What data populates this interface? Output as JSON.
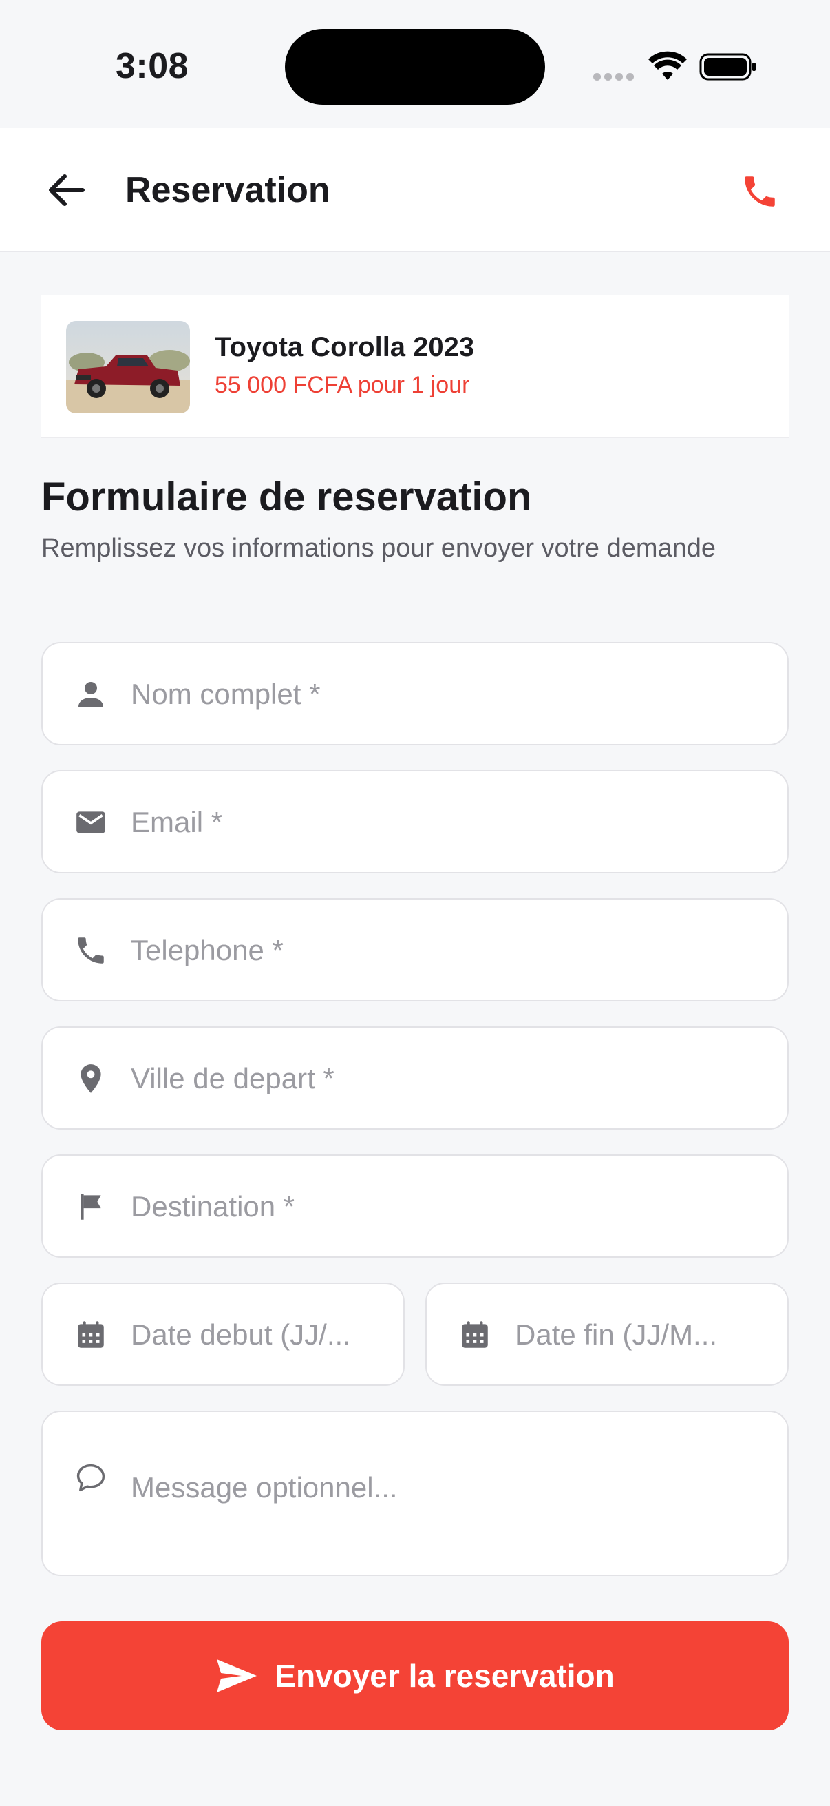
{
  "status_bar": {
    "time": "3:08"
  },
  "app_bar": {
    "title": "Reservation",
    "back_icon": "arrow-left-icon",
    "call_icon": "phone-icon"
  },
  "car": {
    "name": "Toyota Corolla 2023",
    "price": "55 000 FCFA pour 1 jour"
  },
  "form": {
    "title": "Formulaire de reservation",
    "subtitle": "Remplissez vos informations pour envoyer votre demande",
    "fields": {
      "full_name": {
        "placeholder": "Nom complet *",
        "icon": "person-icon"
      },
      "email": {
        "placeholder": "Email *",
        "icon": "mail-icon"
      },
      "phone": {
        "placeholder": "Telephone *",
        "icon": "phone-icon"
      },
      "departure": {
        "placeholder": "Ville de depart *",
        "icon": "location-pin-icon"
      },
      "destination": {
        "placeholder": "Destination *",
        "icon": "flag-icon"
      },
      "start_date": {
        "placeholder": "Date debut (JJ/...",
        "icon": "calendar-icon"
      },
      "end_date": {
        "placeholder": "Date fin (JJ/M...",
        "icon": "calendar-icon"
      },
      "message": {
        "placeholder": "Message optionnel...",
        "icon": "chat-bubble-icon"
      }
    },
    "submit_label": "Envoyer la reservation"
  },
  "colors": {
    "accent": "#f44336",
    "price": "#ee4035",
    "background": "#f6f7f9",
    "field_border": "#e2e2e6",
    "placeholder": "#9b9ba1",
    "icon": "#6b6b70"
  }
}
